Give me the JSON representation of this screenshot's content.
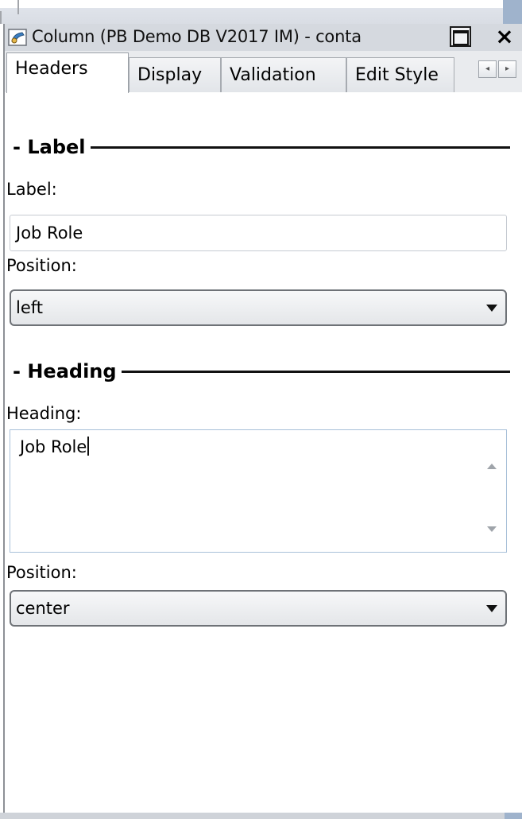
{
  "window": {
    "title": "Column (PB Demo DB V2017 IM) - conta",
    "icons": {
      "app": "column-properties-icon",
      "maximize": "maximize-icon",
      "close": "close-icon"
    },
    "close_glyph": "×"
  },
  "tabs": [
    {
      "label": "Headers",
      "active": true
    },
    {
      "label": "Display",
      "active": false
    },
    {
      "label": "Validation",
      "active": false
    },
    {
      "label": "Edit Style",
      "active": false
    }
  ],
  "tab_scroll": {
    "left": "◂",
    "right": "▸"
  },
  "label_section": {
    "title": "Label",
    "label_field": {
      "caption": "Label:",
      "value": "Job Role"
    },
    "position_field": {
      "caption": "Position:",
      "value": "left"
    }
  },
  "heading_section": {
    "title": "Heading",
    "heading_field": {
      "caption": "Heading:",
      "value": "Job Role"
    },
    "position_field": {
      "caption": "Position:",
      "value": "center"
    }
  },
  "colors": {
    "titlebar": "#d5d9df",
    "tabrow": "#e9ebee",
    "textarea_border": "#a8c0d9"
  }
}
